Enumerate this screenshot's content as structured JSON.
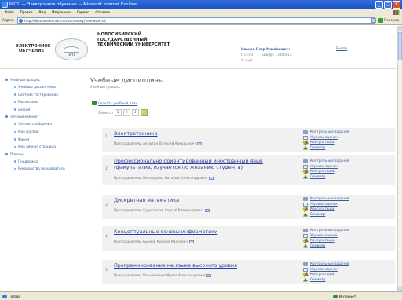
{
  "window": {
    "title": "NSTU — Электронное обучение — Microsoft Internet Explorer"
  },
  "menubar": [
    "Файл",
    "Правка",
    "Вид",
    "Избранное",
    "Сервис",
    "Справка"
  ],
  "address": {
    "label": "Адрес:",
    "url": "http://dictane.edu.nstu.ru/courses/my/?semester=4",
    "go_label": "Переход"
  },
  "header": {
    "logo_text": "ЭЛЕКТРОННОЕ ОБУЧЕНИЕ",
    "crest_text": "НГТУ",
    "university": "НОВОСИБИРСКИЙ ГОСУДАРСТВЕННЫЙ ТЕХНИЧЕСКИЙ УНИВЕРСИТЕТ",
    "user_name": "Иванов Петр Михайлович",
    "group": "СТЭ-83",
    "code": "Шифр: 13486614",
    "form": "Очный",
    "logout": "Выйти"
  },
  "sidebar": {
    "sections": [
      {
        "label": "Учебный процесс",
        "items": [
          "Учебные дисциплины",
          "Система тестирования",
          "Расписание",
          "Сессия"
        ]
      },
      {
        "label": "Личный кабинет",
        "items": [
          "Личные сообщения",
          "Моя группа",
          "Форум",
          "Моя личная страница"
        ]
      },
      {
        "label": "Помощь",
        "items": [
          "Поддержка",
          "Руководство пользователя"
        ]
      }
    ]
  },
  "main": {
    "title": "Учебные дисциплины",
    "subtitle": "Учебный процесс",
    "download": "Скачать учебный план",
    "semester_label": "Семестр",
    "semesters": [
      "1",
      "2",
      "3",
      "4"
    ],
    "active_semester": "4"
  },
  "course_links": {
    "tasks": "Контрольные задания",
    "journal": "Журнал оценок",
    "consult": "Консультации",
    "seminar": "Семинар"
  },
  "courses": [
    {
      "num": "1",
      "name": "Электротехника",
      "teacher": "Преподаватель: Аксютин Валерий Аркадьевич"
    },
    {
      "num": "2",
      "name": "Профессионально ориентированный иностранный язык (факультатив, изучается по желанию студента)",
      "teacher": "Преподаватель: Белоцерова Наталья Александровна"
    },
    {
      "num": "3",
      "name": "Дискретная математика",
      "teacher": "Преподаватель: Судоплатов Сергей Владимирович"
    },
    {
      "num": "4",
      "name": "Концептуальные основы информатики",
      "teacher": "Преподаватель: Бычков Михаил Иванович"
    },
    {
      "num": "5",
      "name": "Программирование на языке высокого уровня",
      "teacher": "Преподаватель: Васильченко Ирина Александровна"
    }
  ],
  "statusbar": {
    "left": "Готово",
    "zone": "Интернет"
  }
}
